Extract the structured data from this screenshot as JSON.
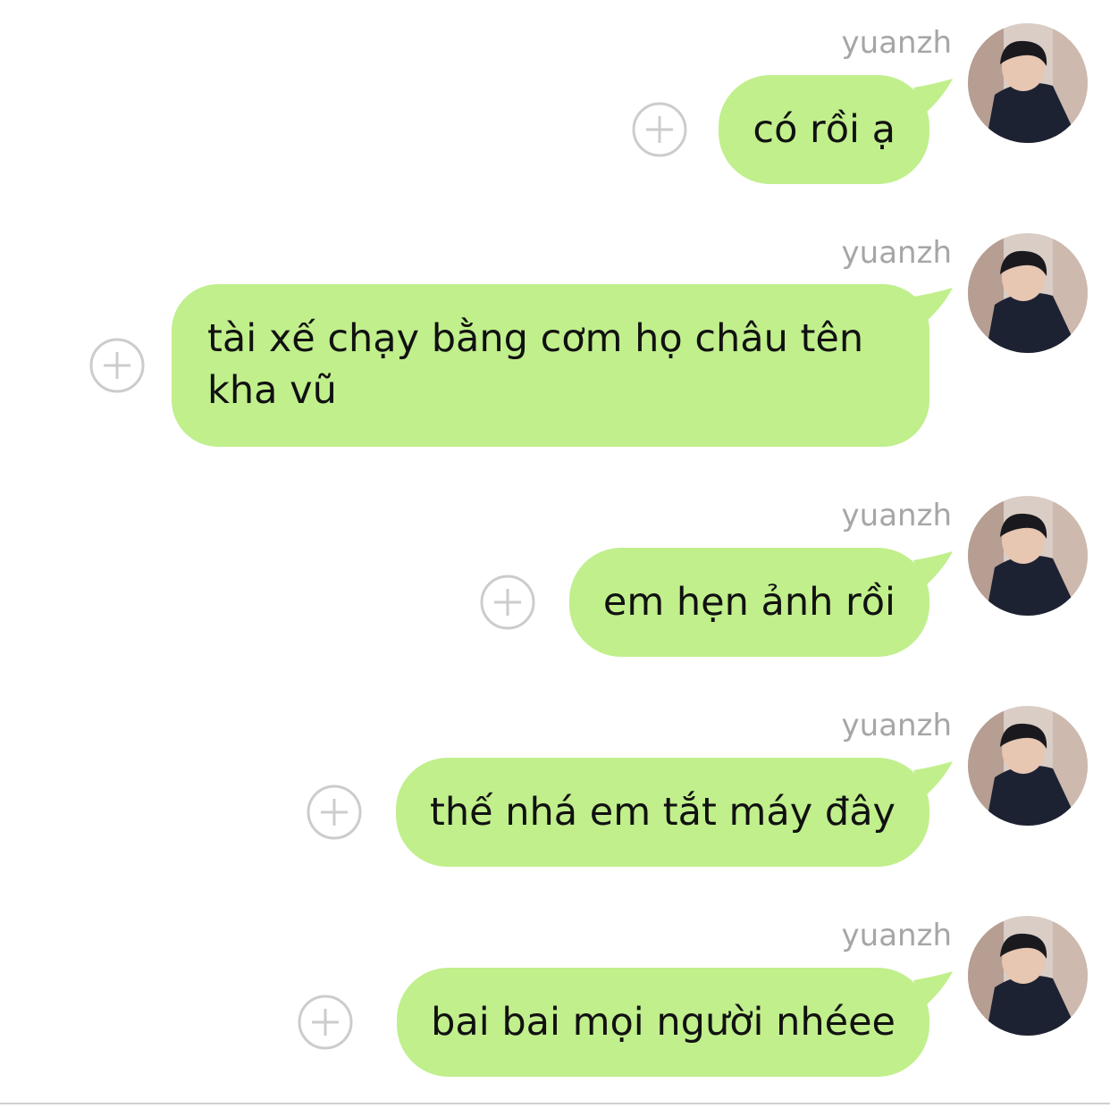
{
  "conversation": {
    "messages": [
      {
        "sender": "yuanzh",
        "text": "có rồi ạ"
      },
      {
        "sender": "yuanzh",
        "text": "tài xế chạy bằng cơm họ châu tên kha vũ"
      },
      {
        "sender": "yuanzh",
        "text": "em hẹn ảnh rồi"
      },
      {
        "sender": "yuanzh",
        "text": "thế nhá em tắt máy đây"
      },
      {
        "sender": "yuanzh",
        "text": "bai bai mọi người nhéee"
      }
    ]
  },
  "colors": {
    "bubble": "#c0ef8c",
    "sender_name": "#a6a6a6",
    "plus_icon": "#cccccc"
  },
  "icons": {
    "add": "plus-circle-icon",
    "avatar": "user-photo"
  }
}
